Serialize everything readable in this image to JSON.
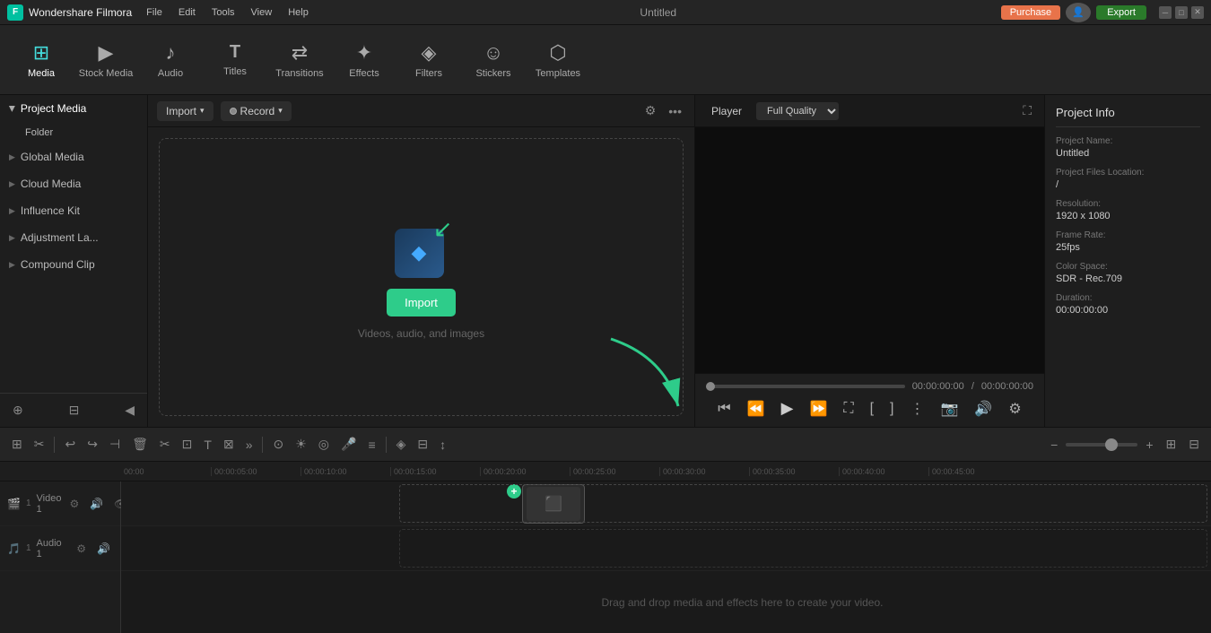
{
  "titleBar": {
    "appName": "Wondershare Filmora",
    "menus": [
      "File",
      "Edit",
      "Tools",
      "View",
      "Help"
    ],
    "title": "Untitled",
    "purchaseLabel": "Purchase",
    "exportLabel": "Export"
  },
  "toolbar": {
    "items": [
      {
        "id": "media",
        "label": "Media",
        "icon": "⊞",
        "active": true
      },
      {
        "id": "stock",
        "label": "Stock Media",
        "icon": "▶"
      },
      {
        "id": "audio",
        "label": "Audio",
        "icon": "♪"
      },
      {
        "id": "titles",
        "label": "Titles",
        "icon": "T"
      },
      {
        "id": "transitions",
        "label": "Transitions",
        "icon": "⟷"
      },
      {
        "id": "effects",
        "label": "Effects",
        "icon": "✦"
      },
      {
        "id": "filters",
        "label": "Filters",
        "icon": "◈"
      },
      {
        "id": "stickers",
        "label": "Stickers",
        "icon": "☺"
      },
      {
        "id": "templates",
        "label": "Templates",
        "icon": "⬡"
      }
    ]
  },
  "leftPanel": {
    "items": [
      {
        "id": "project-media",
        "label": "Project Media",
        "expanded": true,
        "active": true
      },
      {
        "id": "folder",
        "label": "Folder",
        "sub": true
      },
      {
        "id": "global-media",
        "label": "Global Media"
      },
      {
        "id": "cloud-media",
        "label": "Cloud Media"
      },
      {
        "id": "influence-kit",
        "label": "Influence Kit"
      },
      {
        "id": "adjustment-la",
        "label": "Adjustment La..."
      },
      {
        "id": "compound-clip",
        "label": "Compound Clip"
      }
    ]
  },
  "mediaPanel": {
    "importLabel": "Import",
    "recordLabel": "Record",
    "dropZone": {
      "buttonLabel": "Import",
      "description": "Videos, audio, and images"
    }
  },
  "player": {
    "tab": "Player",
    "quality": "Full Quality",
    "currentTime": "00:00:00:00",
    "totalTime": "00:00:00:00"
  },
  "projectInfo": {
    "title": "Project Info",
    "fields": [
      {
        "label": "Project Name:",
        "value": "Untitled"
      },
      {
        "label": "Project Files\nLocation:",
        "value": "/"
      },
      {
        "label": "Resolution:",
        "value": "1920 x 1080"
      },
      {
        "label": "Frame Rate:",
        "value": "25fps"
      },
      {
        "label": "Color Space:",
        "value": "SDR - Rec.709"
      },
      {
        "label": "Duration:",
        "value": "00:00:00:00"
      }
    ]
  },
  "timeline": {
    "ruler": [
      "00:00",
      "00:00:05:00",
      "00:00:10:00",
      "00:00:15:00",
      "00:00:20:00",
      "00:00:25:00",
      "00:00:30:00",
      "00:00:35:00",
      "00:00:40:00",
      "00:00:45:00"
    ],
    "tracks": [
      {
        "id": "video1",
        "label": "Video 1",
        "type": "video",
        "num": 1
      },
      {
        "id": "audio1",
        "label": "Audio 1",
        "type": "audio",
        "num": 1
      }
    ],
    "dropLabel": "Drag and drop media and effects here to create your video."
  }
}
